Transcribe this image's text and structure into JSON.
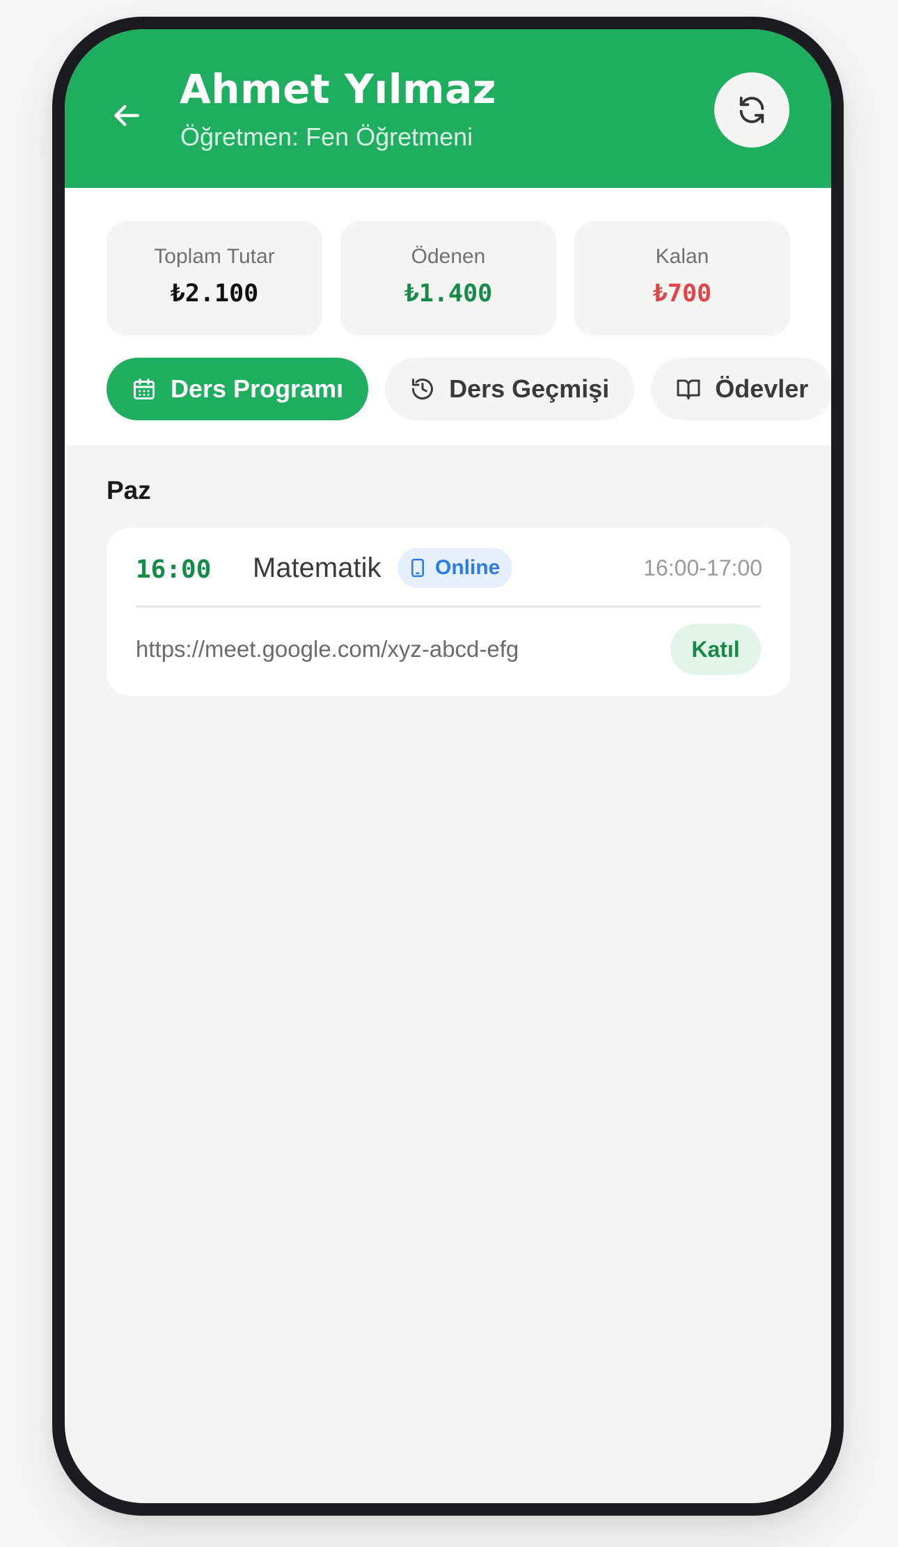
{
  "header": {
    "title": "Ahmet Yılmaz",
    "subtitle": "Öğretmen: Fen Öğretmeni",
    "back_icon": "arrow-left-icon",
    "refresh_icon": "refresh-icon"
  },
  "stats": [
    {
      "label": "Toplam Tutar",
      "value": "₺2.100",
      "color": "#111111"
    },
    {
      "label": "Ödenen",
      "value": "₺1.400",
      "color": "#168a48"
    },
    {
      "label": "Kalan",
      "value": "₺700",
      "color": "#e0454b"
    }
  ],
  "tabs": [
    {
      "label": "Ders Programı",
      "icon": "calendar-icon",
      "active": true
    },
    {
      "label": "Ders Geçmişi",
      "icon": "history-icon",
      "active": false
    },
    {
      "label": "Ödevler",
      "icon": "book-icon",
      "active": false
    }
  ],
  "schedule": {
    "day": "Paz",
    "lessons": [
      {
        "time": "16:00",
        "subject": "Matematik",
        "mode": "Online",
        "mode_icon": "phone-icon",
        "range": "16:00-17:00",
        "link": "https://meet.google.com/xyz-abcd-efg",
        "join_label": "Katıl"
      }
    ]
  },
  "colors": {
    "primary": "#1fad5f",
    "paid": "#168a48",
    "remaining": "#e0454b",
    "online": "#2d7be5"
  }
}
